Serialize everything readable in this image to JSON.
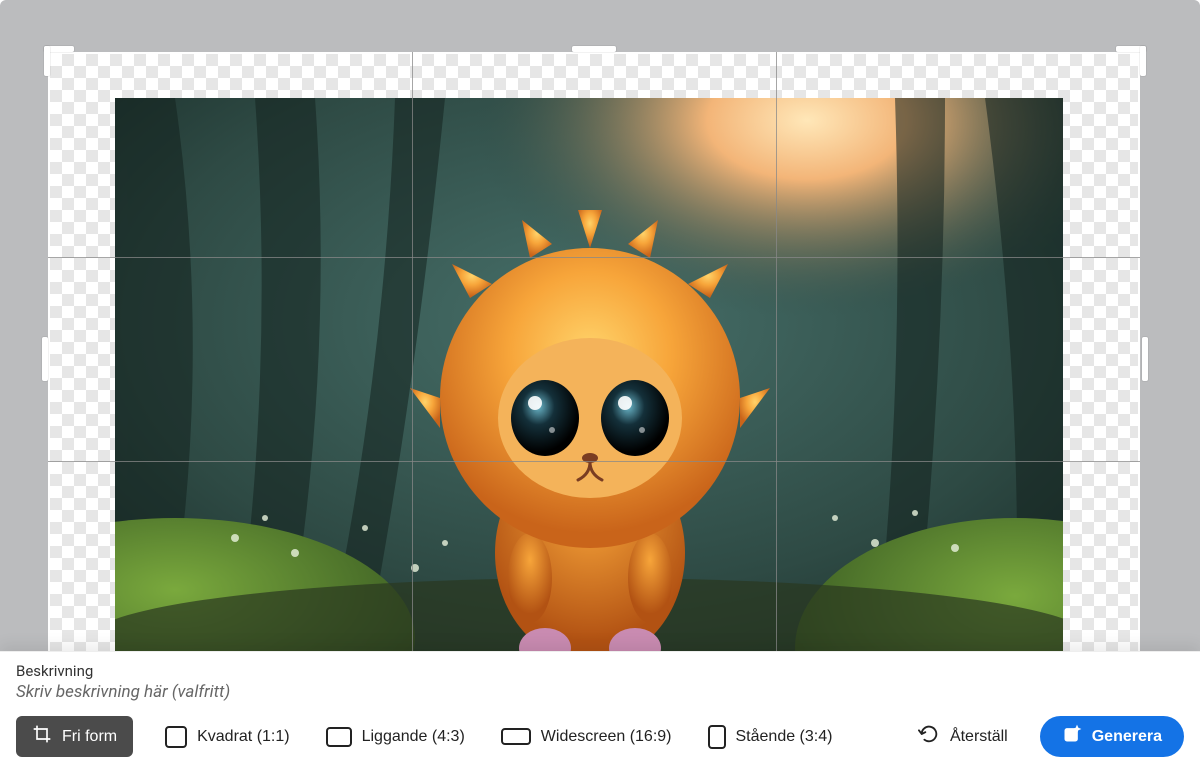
{
  "description": {
    "label": "Beskrivning",
    "placeholder": "Skriv beskrivning här (valfritt)"
  },
  "toolbar": {
    "freeform": "Fri form",
    "square": "Kvadrat (1:1)",
    "landscape": "Liggande (4:3)",
    "widescreen": "Widescreen (16:9)",
    "portrait": "Stående (3:4)",
    "reset": "Återställ",
    "generate": "Generera"
  },
  "icons": {
    "freeform": "crop-icon",
    "reset": "undo-icon",
    "generate": "sparkle-icon"
  },
  "image": {
    "subject": "fluffy orange creature with big eyes in misty green forest",
    "accent_color": "#f08a1f",
    "bg_color": "#2e4a44"
  }
}
